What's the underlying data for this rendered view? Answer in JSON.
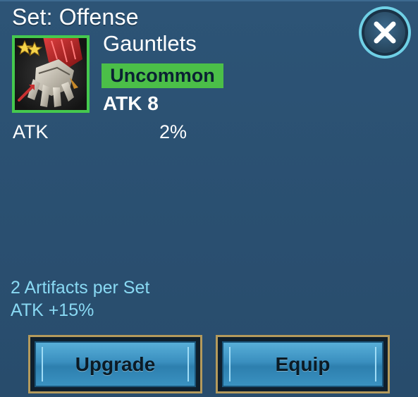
{
  "title": "Set: Offense",
  "item": {
    "name": "Gauntlets",
    "rarity": "Uncommon",
    "main_stat": "ATK 8",
    "stars": 2,
    "icon": "gauntlet-icon",
    "sub_stats": [
      {
        "name": "ATK",
        "value": "2%"
      }
    ]
  },
  "set_bonus": {
    "count_text": "2 Artifacts per Set",
    "bonus_text": "ATK +15%"
  },
  "buttons": {
    "upgrade": "Upgrade",
    "equip": "Equip",
    "close": "close-icon"
  },
  "colors": {
    "background": "#2b5172",
    "rarity": "#4bbf48",
    "set_text": "#89d9f3",
    "button_border": "#b49a5c",
    "button_fill": "#3a8fbf"
  }
}
